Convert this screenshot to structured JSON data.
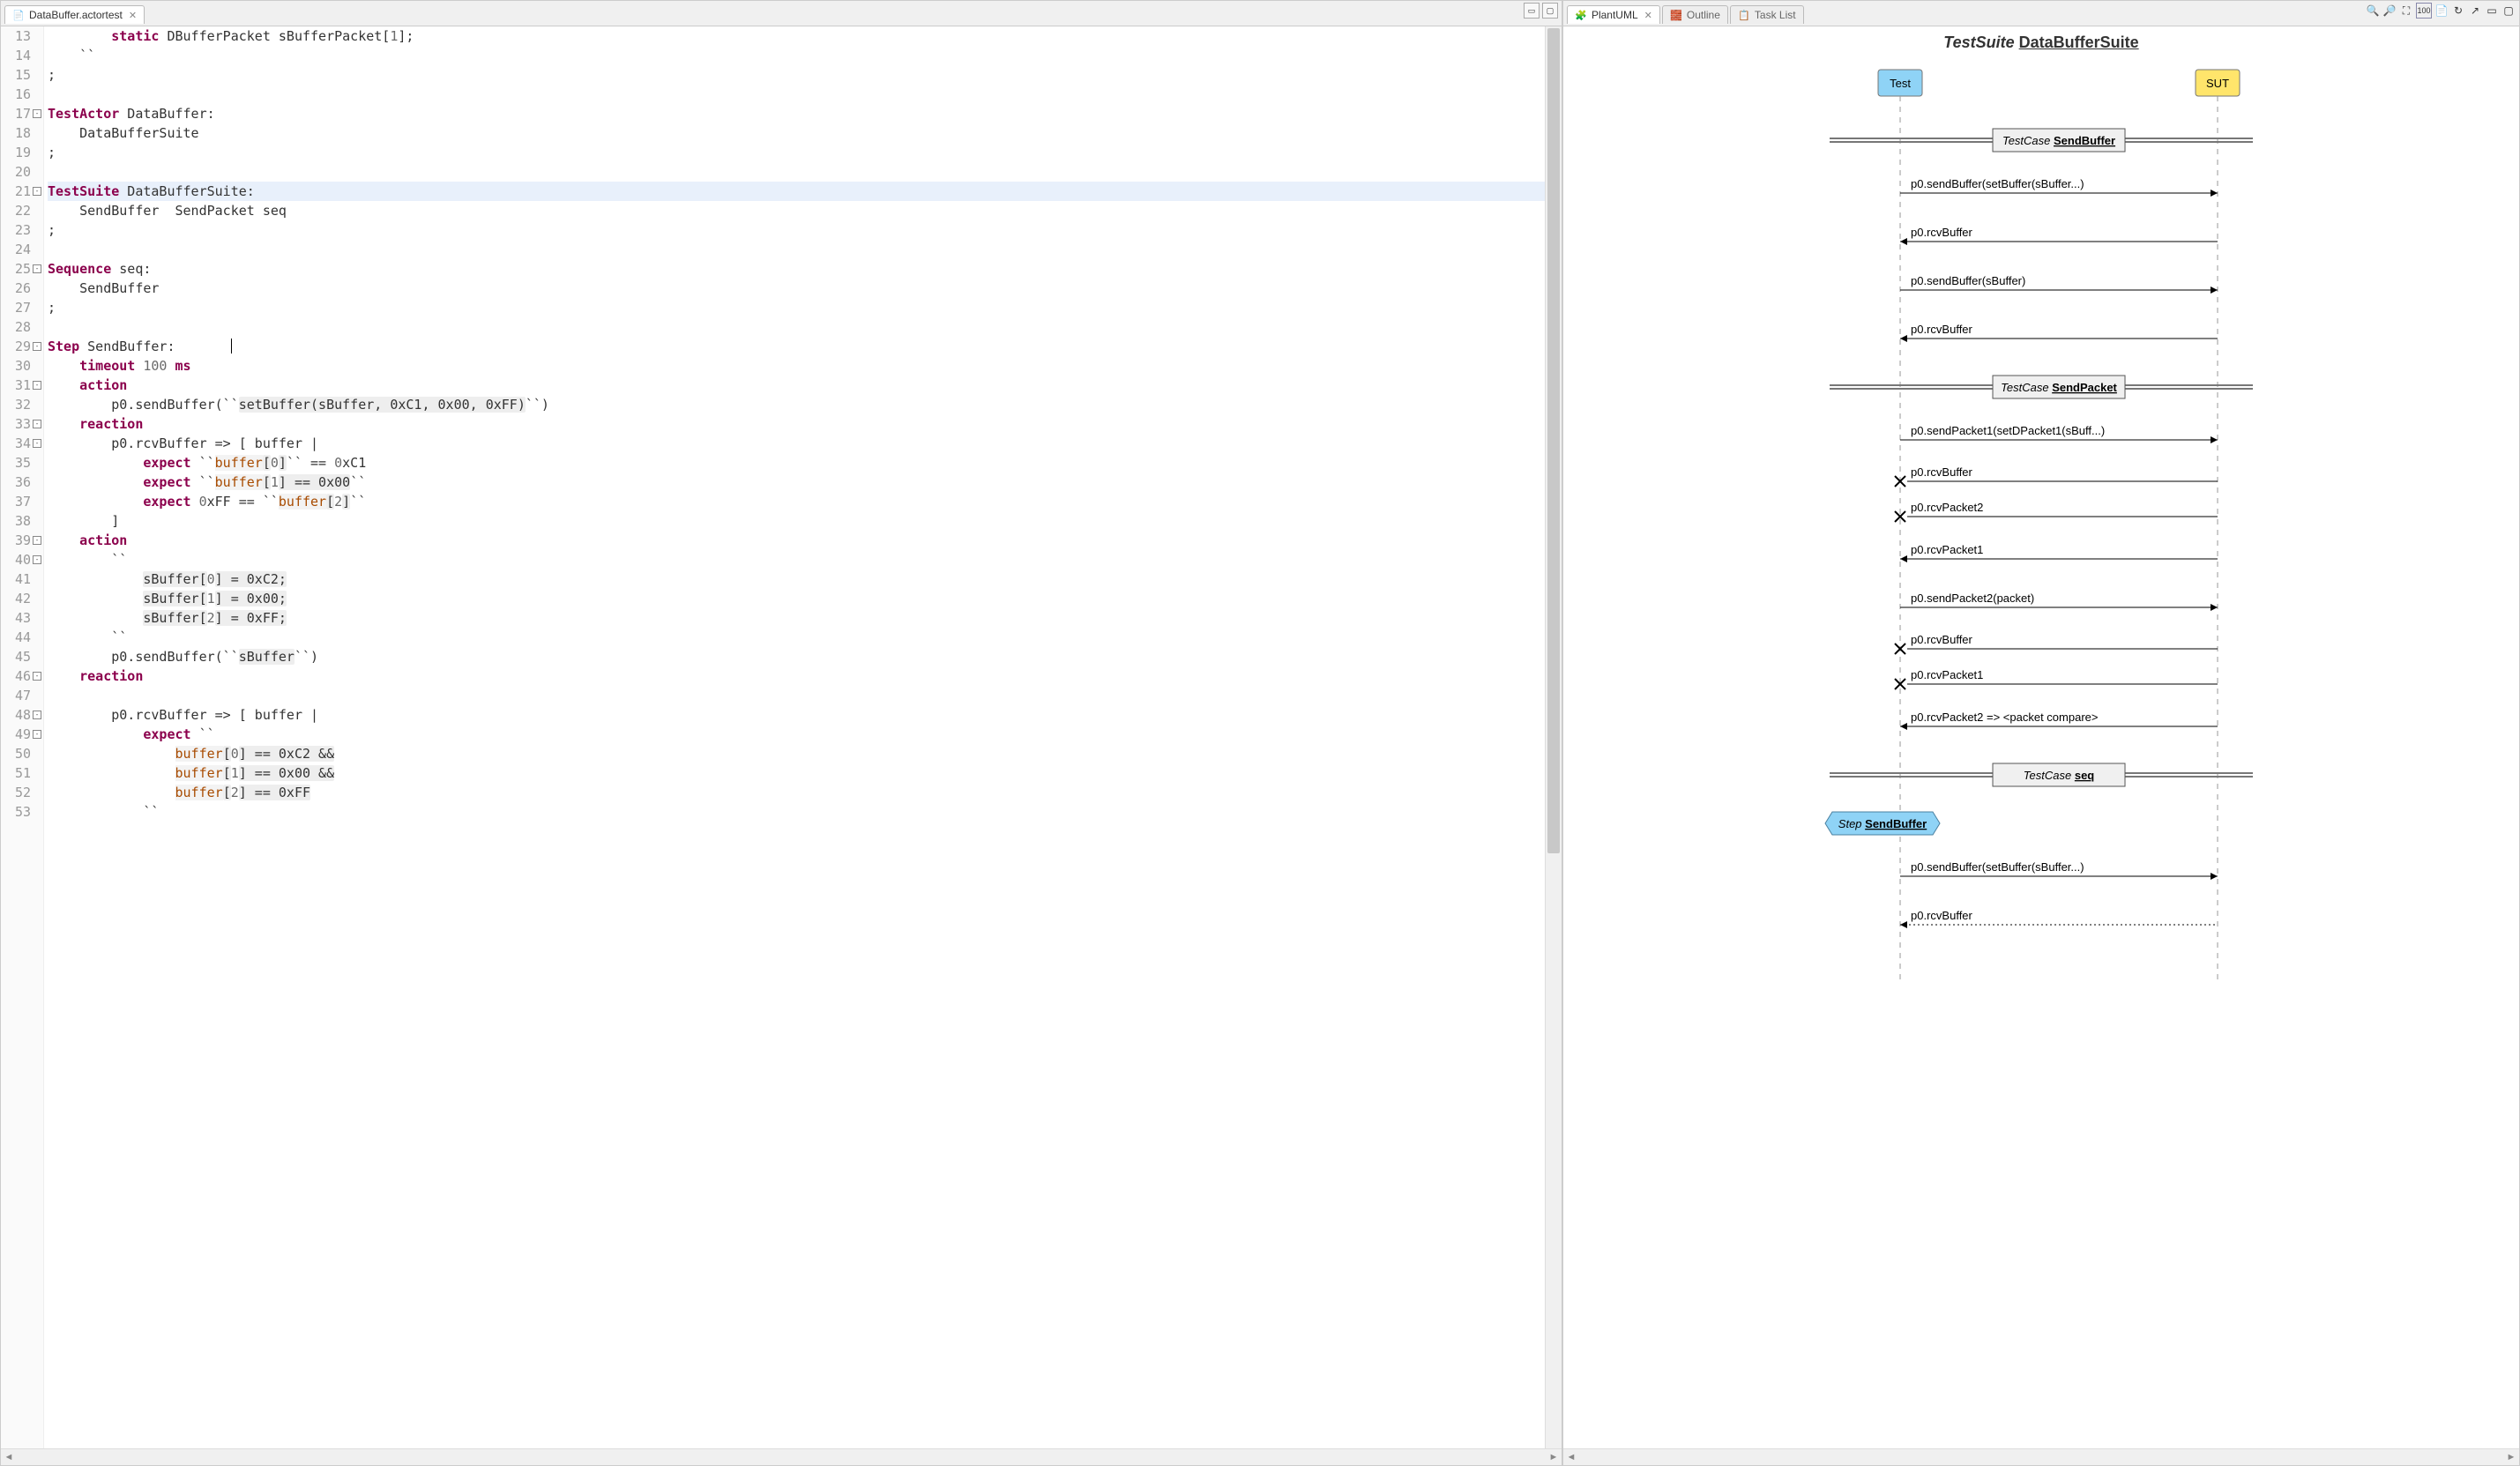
{
  "left": {
    "tabTitle": "DataBuffer.actortest",
    "lines": [
      {
        "n": 13,
        "html": "        <span class='kw'>static</span> DBufferPacket sBufferPacket[<span class='num'>1</span>];"
      },
      {
        "n": 14,
        "html": "    ``"
      },
      {
        "n": 15,
        "html": ";"
      },
      {
        "n": 16,
        "html": ""
      },
      {
        "n": 17,
        "fold": true,
        "html": "<span class='kw'>TestActor</span> DataBuffer:"
      },
      {
        "n": 18,
        "html": "    DataBufferSuite"
      },
      {
        "n": 19,
        "html": ";"
      },
      {
        "n": 20,
        "html": ""
      },
      {
        "n": 21,
        "fold": true,
        "hl": true,
        "html": "<span class='kw'>TestSuite</span> DataBufferSuite:"
      },
      {
        "n": 22,
        "html": "    SendBuffer  SendPacket seq"
      },
      {
        "n": 23,
        "html": ";"
      },
      {
        "n": 24,
        "html": ""
      },
      {
        "n": 25,
        "fold": true,
        "html": "<span class='kw'>Sequence</span> seq:"
      },
      {
        "n": 26,
        "html": "    SendBuffer"
      },
      {
        "n": 27,
        "html": ";"
      },
      {
        "n": 28,
        "html": ""
      },
      {
        "n": 29,
        "fold": true,
        "html": "<span class='kw'>Step</span> SendBuffer:       <span class='text-cursor'></span>"
      },
      {
        "n": 30,
        "html": "    <span class='kw'>timeout</span> <span class='num'>100</span> <span class='kw'>ms</span>"
      },
      {
        "n": 31,
        "fold": true,
        "html": "    <span class='kw'>action</span>"
      },
      {
        "n": 32,
        "html": "        p0.sendBuffer(``<span class='embed'>setBuffer(sBuffer, 0xC1, 0x00, 0xFF)</span>``)"
      },
      {
        "n": 33,
        "fold": true,
        "html": "    <span class='kw'>reaction</span>"
      },
      {
        "n": 34,
        "fold": true,
        "html": "        p0.rcvBuffer =&gt; [ buffer |"
      },
      {
        "n": 35,
        "html": "            <span class='kw'>expect</span> ``<span class='hlvar'>buffer</span><span class='embed'>[</span><span class='num'>0</span><span class='embed'>]</span>`` == <span class='num'>0</span>xC1"
      },
      {
        "n": 36,
        "html": "            <span class='kw'>expect</span> ``<span class='hlvar'>buffer</span><span class='embed'>[</span><span class='num'>1</span><span class='embed'>] == 0x00</span>``"
      },
      {
        "n": 37,
        "html": "            <span class='kw'>expect</span> <span class='num'>0</span>xFF == ``<span class='hlvar'>buffer</span><span class='embed'>[</span><span class='num'>2</span><span class='embed'>]</span>``"
      },
      {
        "n": 38,
        "html": "        ]"
      },
      {
        "n": 39,
        "fold": true,
        "html": "    <span class='kw'>action</span>"
      },
      {
        "n": 40,
        "fold": true,
        "html": "        ``"
      },
      {
        "n": 41,
        "html": "            <span class='embed'>sBuffer[</span><span class='num'>0</span><span class='embed'>] = 0xC2;</span>"
      },
      {
        "n": 42,
        "html": "            <span class='embed'>sBuffer[</span><span class='num'>1</span><span class='embed'>] = 0x00;</span>"
      },
      {
        "n": 43,
        "html": "            <span class='embed'>sBuffer[</span><span class='num'>2</span><span class='embed'>] = 0xFF;</span>"
      },
      {
        "n": 44,
        "html": "        ``"
      },
      {
        "n": 45,
        "html": "        p0.sendBuffer(``<span class='embed'>sBuffer</span>``)"
      },
      {
        "n": 46,
        "fold": true,
        "html": "    <span class='kw'>reaction</span>"
      },
      {
        "n": 47,
        "html": ""
      },
      {
        "n": 48,
        "fold": true,
        "html": "        p0.rcvBuffer =&gt; [ buffer |"
      },
      {
        "n": 49,
        "fold": true,
        "html": "            <span class='kw'>expect</span> ``"
      },
      {
        "n": 50,
        "html": "                <span class='hlvar'>buffer</span><span class='embed'>[</span><span class='num'>0</span><span class='embed'>] == 0xC2 &amp;&amp;</span>"
      },
      {
        "n": 51,
        "html": "                <span class='hlvar'>buffer</span><span class='embed'>[</span><span class='num'>1</span><span class='embed'>] == 0x00 &amp;&amp;</span>"
      },
      {
        "n": 52,
        "html": "                <span class='hlvar'>buffer</span><span class='embed'>[</span><span class='num'>2</span><span class='embed'>] == 0xFF</span>"
      },
      {
        "n": 53,
        "html": "            ``"
      }
    ]
  },
  "right": {
    "tabs": [
      {
        "label": "PlantUML",
        "active": true
      },
      {
        "label": "Outline",
        "active": false
      },
      {
        "label": "Task List",
        "active": false
      }
    ],
    "titlePrefix": "TestSuite",
    "titleName": "DataBufferSuite",
    "participants": [
      {
        "name": "Test",
        "color": "#8fd3f6"
      },
      {
        "name": "SUT",
        "color": "#ffe56b"
      }
    ],
    "blocks": [
      {
        "type": "testcase",
        "label": "TestCase",
        "name": "SendBuffer"
      },
      {
        "type": "msg",
        "dir": "right",
        "text": "p0.sendBuffer(setBuffer(sBuffer...)"
      },
      {
        "type": "msg",
        "dir": "left",
        "text": "p0.rcvBuffer"
      },
      {
        "type": "msg",
        "dir": "right",
        "text": "p0.sendBuffer(sBuffer)"
      },
      {
        "type": "msg",
        "dir": "left",
        "text": "p0.rcvBuffer"
      },
      {
        "type": "testcase",
        "label": "TestCase",
        "name": "SendPacket"
      },
      {
        "type": "msg",
        "dir": "right",
        "text": "p0.sendPacket1(setDPacket1(sBuff...)"
      },
      {
        "type": "neg",
        "text": "p0.rcvBuffer"
      },
      {
        "type": "neg",
        "text": "p0.rcvPacket2"
      },
      {
        "type": "msg",
        "dir": "left",
        "text": "p0.rcvPacket1"
      },
      {
        "type": "msg",
        "dir": "right",
        "text": "p0.sendPacket2(packet)"
      },
      {
        "type": "neg",
        "text": "p0.rcvBuffer"
      },
      {
        "type": "neg",
        "text": "p0.rcvPacket1"
      },
      {
        "type": "msg",
        "dir": "left",
        "text": "p0.rcvPacket2 => <packet compare>"
      },
      {
        "type": "testcase",
        "label": "TestCase",
        "name": "seq"
      },
      {
        "type": "step",
        "label": "Step",
        "name": "SendBuffer"
      },
      {
        "type": "msg",
        "dir": "right",
        "text": "p0.sendBuffer(setBuffer(sBuffer...)"
      },
      {
        "type": "msg",
        "dir": "left",
        "text": "p0.rcvBuffer",
        "cut": true
      }
    ]
  }
}
